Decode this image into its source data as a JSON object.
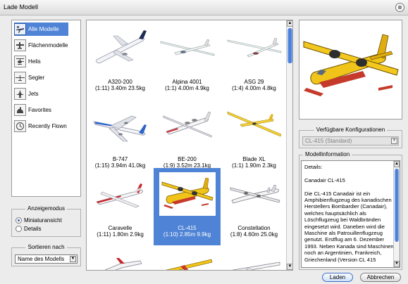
{
  "window": {
    "title": "Lade Modell",
    "close_glyph": "⊗"
  },
  "categories": [
    {
      "label": "Alle Modelle",
      "icon": "all-models-icon",
      "selected": true
    },
    {
      "label": "Flächenmodelle",
      "icon": "fixed-wing-icon",
      "selected": false
    },
    {
      "label": "Helis",
      "icon": "helicopter-icon",
      "selected": false
    },
    {
      "label": "Segler",
      "icon": "glider-icon",
      "selected": false
    },
    {
      "label": "Jets",
      "icon": "jet-icon",
      "selected": false
    },
    {
      "label": "Favorites",
      "icon": "favorites-icon",
      "selected": false
    },
    {
      "label": "Recently Flown",
      "icon": "recently-flown-icon",
      "selected": false
    }
  ],
  "display_mode": {
    "title": "Anzeigemodus",
    "options": [
      {
        "label": "Miniaturansicht",
        "checked": true
      },
      {
        "label": "Details",
        "checked": false
      }
    ]
  },
  "sort": {
    "title": "Sortieren nach",
    "value": "Name des Modells",
    "arrow": "▼"
  },
  "models": [
    {
      "name": "A320-200",
      "spec": "(1:11) 3.40m 23.5kg",
      "kind": "airliner-lufthansa",
      "selected": false
    },
    {
      "name": "Alpina 4001",
      "spec": "(1:1) 4.00m 4.9kg",
      "kind": "glider-white",
      "selected": false
    },
    {
      "name": "ASG 29",
      "spec": "(1:4) 4.00m 4.8kg",
      "kind": "glider-slim",
      "selected": false
    },
    {
      "name": "B-747",
      "spec": "(1:15) 3.94m 41.0kg",
      "kind": "airliner-747",
      "selected": false
    },
    {
      "name": "BE-200",
      "spec": "(1:9) 3.52m 23.1kg",
      "kind": "amphibian-jet",
      "selected": false
    },
    {
      "name": "Blade XL",
      "spec": "(1:1) 1.90m 2.3kg",
      "kind": "glider-yellow",
      "selected": false
    },
    {
      "name": "Caravelle",
      "spec": "(1:11) 1.80m 2.9kg",
      "kind": "jet-red",
      "selected": false
    },
    {
      "name": "CL-415",
      "spec": "(1:10) 2.85m 9.9kg",
      "kind": "waterbomber",
      "selected": true
    },
    {
      "name": "Constellation",
      "spec": "(1:8) 4.60m 25.0kg",
      "kind": "propliner",
      "selected": false
    }
  ],
  "configurations": {
    "title": "Verfügbare Konfigurationen",
    "value": "CL-415 (Standard)",
    "arrow": "▼"
  },
  "model_info": {
    "title": "Modellinformation",
    "text": "Details:\n\nCanadair CL-415\n\nDie CL-415 Canadair ist ein Amphibienflugzeug des kanadischen Herstellers Bombardier (Canadair), welches hauptsächlich als Löschflugzeug bei Waldbränden eingesetzt wird. Daneben wird die Maschine als Patrouillenflugzeug genutzt. Erstflug am 6. Dezember 1993. Neben Kanada sind Maschinen noch an Argentinien, Frankreich, Griechenland (Version CL 415"
  },
  "buttons": {
    "load": "Laden",
    "cancel": "Abbrechen"
  },
  "scroll_glyphs": {
    "up": "▲",
    "down": "▼"
  },
  "colors": {
    "selection": "#4f83d6",
    "background": "#ececec"
  }
}
